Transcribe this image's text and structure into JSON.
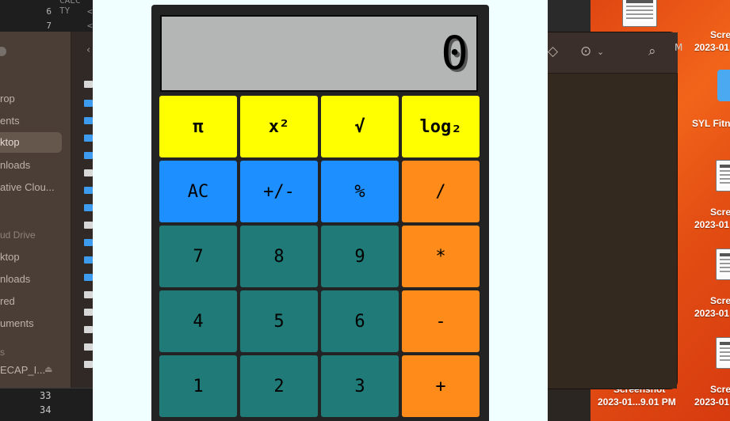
{
  "editor": {
    "top_lines": [
      {
        "num": "",
        "code": "CALC TY"
      },
      {
        "num": "6",
        "code": "<"
      },
      {
        "num": "7",
        "code": "<"
      }
    ],
    "bottom_lines": [
      "33",
      "34"
    ]
  },
  "finder": {
    "sidebar_items": [
      {
        "label": "rop",
        "selected": false
      },
      {
        "label": "ents",
        "selected": false
      },
      {
        "label": "ktop",
        "selected": true
      },
      {
        "label": "nloads",
        "selected": false
      },
      {
        "label": "ative Clou...",
        "selected": false
      },
      {
        "label": "ud Drive",
        "selected": false
      },
      {
        "label": "ktop",
        "selected": false
      },
      {
        "label": "nloads",
        "selected": false
      },
      {
        "label": "red",
        "selected": false
      },
      {
        "label": "uments",
        "selected": false
      },
      {
        "label": "s",
        "selected": false
      },
      {
        "label": "ECAP_I...",
        "selected": false
      }
    ]
  },
  "calculator": {
    "display": "0",
    "keys": [
      {
        "label": "π",
        "kind": "fn"
      },
      {
        "label": "x²",
        "kind": "fn"
      },
      {
        "label": "√",
        "kind": "fn"
      },
      {
        "label": "log₂",
        "kind": "fn"
      },
      {
        "label": "AC",
        "kind": "util"
      },
      {
        "label": "+/-",
        "kind": "util"
      },
      {
        "label": "%",
        "kind": "util"
      },
      {
        "label": "/",
        "kind": "op"
      },
      {
        "label": "7",
        "kind": "num"
      },
      {
        "label": "8",
        "kind": "num"
      },
      {
        "label": "9",
        "kind": "num"
      },
      {
        "label": "*",
        "kind": "op"
      },
      {
        "label": "4",
        "kind": "num"
      },
      {
        "label": "5",
        "kind": "num"
      },
      {
        "label": "6",
        "kind": "num"
      },
      {
        "label": "-",
        "kind": "op"
      },
      {
        "label": "1",
        "kind": "num"
      },
      {
        "label": "2",
        "kind": "num"
      },
      {
        "label": "3",
        "kind": "num"
      },
      {
        "label": "+",
        "kind": "op"
      }
    ]
  },
  "midwindow": {
    "toolbar": {
      "tag": "tag-icon",
      "more": "ellipsis-circle-icon",
      "search": "search-icon"
    },
    "side_text": "M"
  },
  "desktop": {
    "items": [
      {
        "label1": "Scre",
        "label2": "2023-01"
      },
      {
        "label1": "SYL Fitn",
        "label2": ""
      },
      {
        "label1": "Scre",
        "label2": "2023-01"
      },
      {
        "label1": "Scre",
        "label2": "2023-01"
      },
      {
        "label1": "Scre",
        "label2": "2023-01"
      },
      {
        "label1": "Screenshot",
        "label2": "2023-01...9.01 PM"
      }
    ]
  },
  "colors": {
    "page_bg": "#f0ffff",
    "fn_key": "#ffff00",
    "util_key": "#1e8fff",
    "op_key": "#ff8c1a",
    "num_key": "#207b78",
    "display_bg": "#b3b6b5"
  }
}
